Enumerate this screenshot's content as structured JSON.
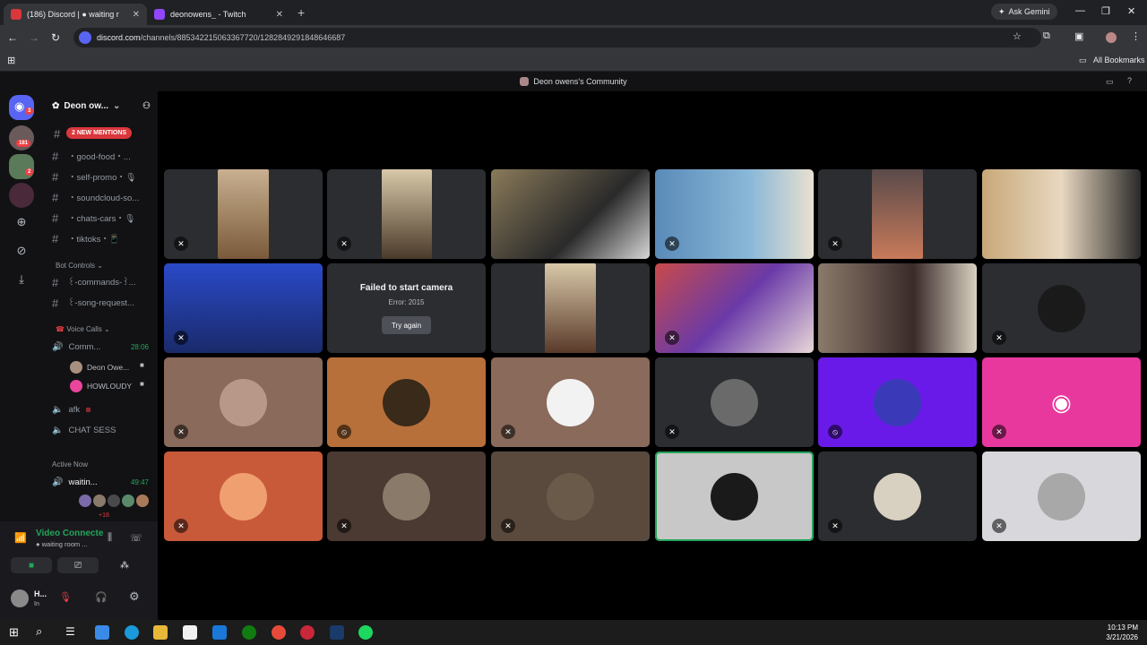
{
  "browser": {
    "tabs": [
      {
        "badge": "186",
        "label": "(186) Discord | ● waiting r",
        "active": true
      },
      {
        "label": "deonowens_ - Twitch",
        "active": false
      }
    ],
    "gemini_label": "Ask Gemini",
    "url_host": "discord.com",
    "url_path": "/channels/885342215063367720/1282849291848646687",
    "bookmarks_label": "All Bookmarks"
  },
  "server_title": "Deon owens's Community",
  "guilds": {
    "dm_badge": "3",
    "items": [
      {
        "badge": "181"
      },
      {
        "badge": "2"
      }
    ]
  },
  "sidebar": {
    "server_name": "Deon ow...",
    "mentions_pill": "2 NEW MENTIONS",
    "channels": [
      {
        "label": "・good-food・..."
      },
      {
        "label": "・self-promo・🎙"
      },
      {
        "label": "・soundcloud-so..."
      },
      {
        "label": "・chats-cars・🎙"
      },
      {
        "label": "・tiktoks・📱"
      }
    ],
    "bot_category": "Bot Controls",
    "bot_channels": [
      {
        "label": "꒰-commands-꒱..."
      },
      {
        "label": "꒰-song-request..."
      }
    ],
    "voice_category": "Voice Calls",
    "voice_channel": "Comm...",
    "voice_timer": "28:06",
    "voice_users": [
      "Deon Owe...",
      "HOWLOUDY"
    ],
    "afk_label": "afk",
    "chat_sess_label": "CHAT SESS",
    "active_now": "Active Now",
    "active_channel": "waitin...",
    "active_timer": "49:47",
    "active_more": "+18"
  },
  "panel": {
    "status": "Video Connecte",
    "sub": "● waiting room ...",
    "username": "H...",
    "user_status": "In"
  },
  "stage": {
    "fail_title": "Failed to start camera",
    "fail_error": "Error: 2015",
    "retry_label": "Try again"
  },
  "taskbar": {
    "time": "10:13 PM",
    "date": "3/21/2026"
  }
}
